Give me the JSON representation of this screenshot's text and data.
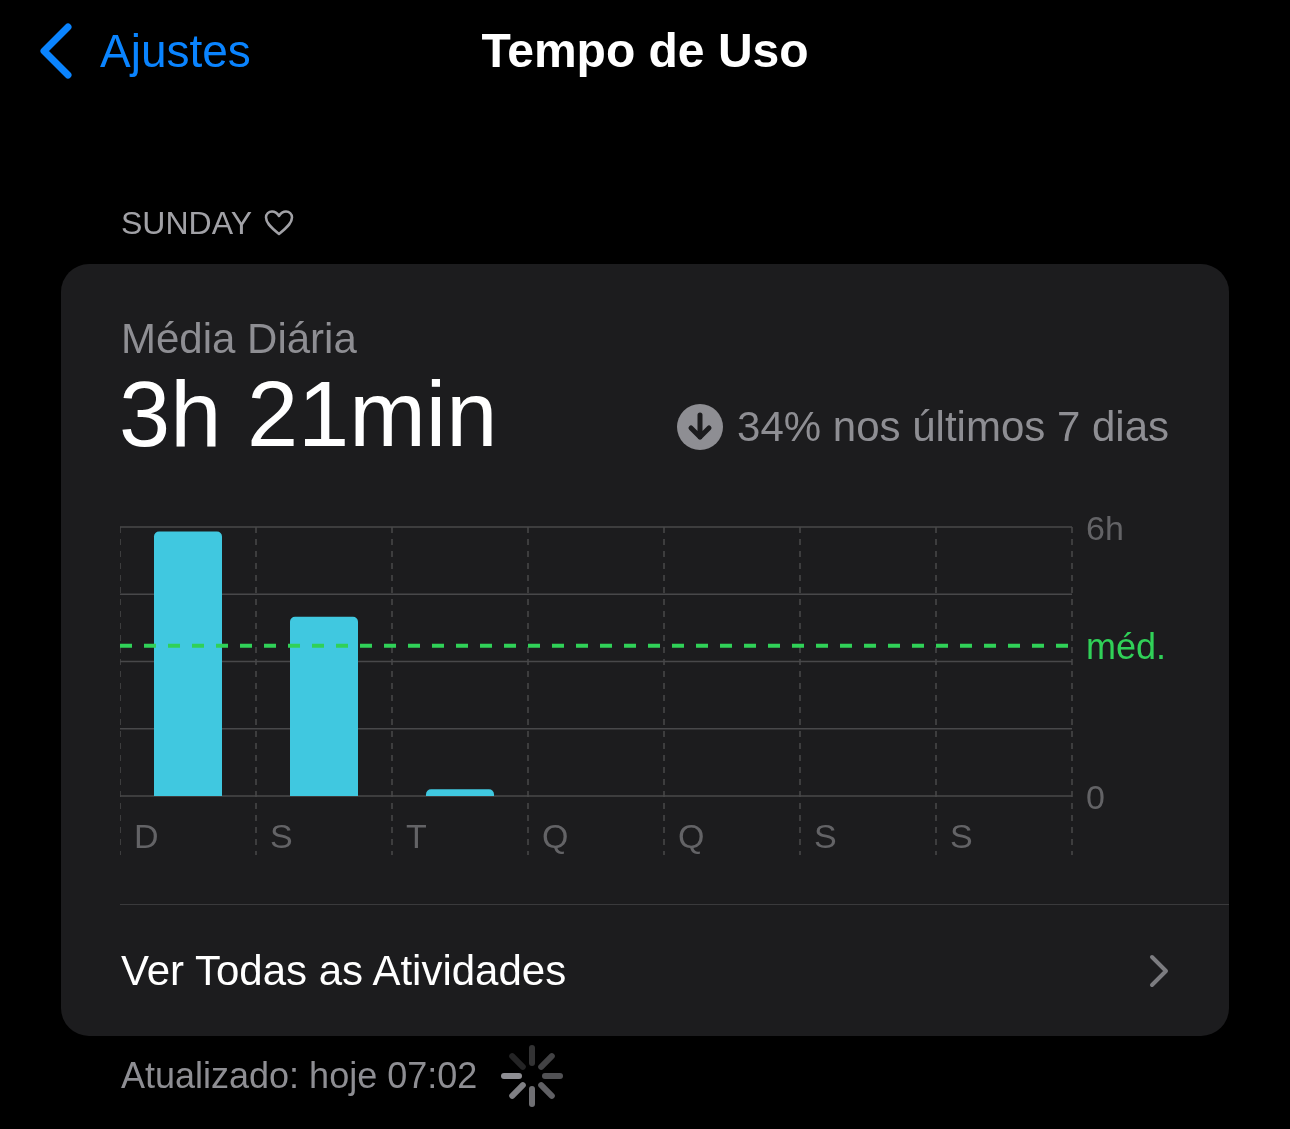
{
  "nav": {
    "back_label": "Ajustes",
    "title": "Tempo de Uso"
  },
  "section_header": "SUNDAY",
  "card": {
    "label": "Média Diária",
    "total": "3h 21min",
    "trend": "34% nos últimos 7 dias",
    "chart_data": {
      "type": "bar",
      "categories": [
        "D",
        "S",
        "T",
        "Q",
        "Q",
        "S",
        "S"
      ],
      "series": [
        {
          "color": "#40c8e0",
          "values": [
            5.9,
            4.0,
            0.15,
            0,
            0,
            0,
            0
          ]
        }
      ],
      "ylim": [
        0,
        6
      ],
      "yticks": [
        {
          "value": 0,
          "label": "0"
        },
        {
          "value": 6,
          "label": "6h"
        }
      ],
      "ref_lines": [
        {
          "axis": "y",
          "value": 3.35,
          "label": "méd.",
          "color": "#30d158"
        }
      ]
    },
    "link": "Ver Todas as Atividades"
  },
  "footer": "Atualizado: hoje 07:02"
}
